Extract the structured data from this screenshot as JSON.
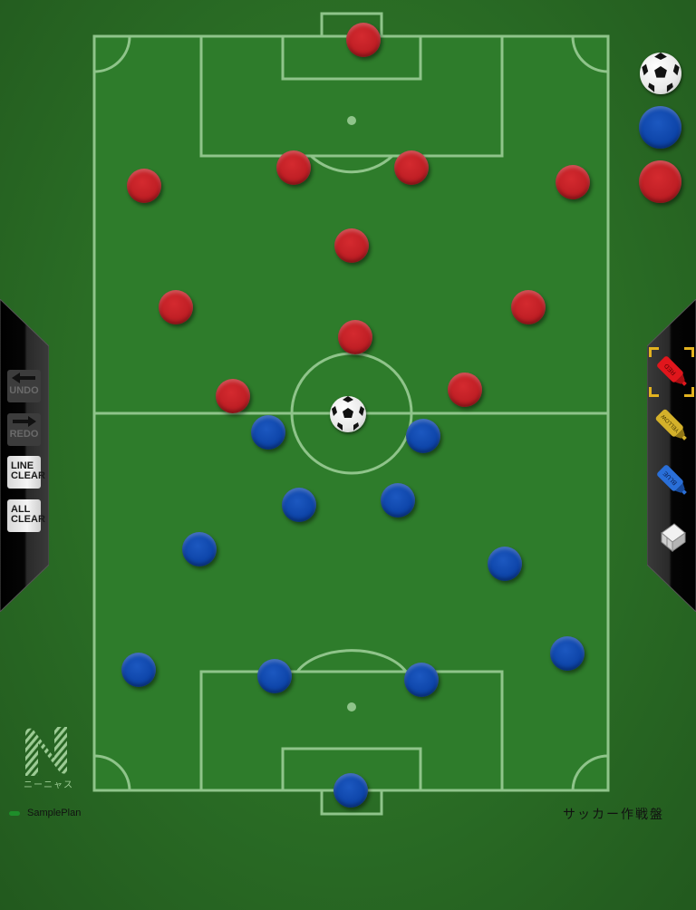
{
  "app": {
    "title": "サッカー作戦盤",
    "brand_text": "ニーニャス",
    "plan_name": "SamplePlan"
  },
  "colors": {
    "pitch": "#2e7c2b",
    "background": "#2a6a25",
    "line": "#8fc48a",
    "red_team": "#be1e24",
    "blue_team": "#0d44a8",
    "selection": "#e2b21f"
  },
  "left_toolbar": {
    "buttons": [
      {
        "id": "undo",
        "icon": "arrow-left-icon",
        "label": "UNDO",
        "enabled": false
      },
      {
        "id": "redo",
        "icon": "arrow-right-icon",
        "label": "REDO",
        "enabled": false
      },
      {
        "id": "line-clear",
        "label_line1": "LINE",
        "label_line2": "CLEAR",
        "enabled": true
      },
      {
        "id": "all-clear",
        "label_line1": "ALL",
        "label_line2": "CLEAR",
        "enabled": true
      }
    ]
  },
  "right_toolbar": {
    "markers": [
      {
        "id": "red",
        "label": "RED",
        "color": "#e0161c",
        "selected": true
      },
      {
        "id": "yellow",
        "label": "YELLOW",
        "color": "#d4b12a",
        "selected": false
      },
      {
        "id": "blue",
        "label": "BLUE",
        "color": "#2a6fd8",
        "selected": false
      },
      {
        "id": "eraser",
        "label": "",
        "icon": "eraser-icon",
        "selected": false
      }
    ]
  },
  "palette": [
    {
      "type": "ball",
      "name": "palette-ball"
    },
    {
      "type": "blue",
      "name": "palette-blue-piece"
    },
    {
      "type": "red",
      "name": "palette-red-piece"
    }
  ],
  "red_team": [
    {
      "role": "goalkeeper"
    },
    {
      "role": "defender"
    },
    {
      "role": "defender"
    },
    {
      "role": "defender"
    },
    {
      "role": "defender"
    },
    {
      "role": "midfielder"
    },
    {
      "role": "midfielder"
    },
    {
      "role": "midfielder"
    },
    {
      "role": "forward"
    },
    {
      "role": "forward"
    },
    {
      "role": "forward"
    }
  ],
  "blue_team": [
    {
      "role": "goalkeeper"
    },
    {
      "role": "defender"
    },
    {
      "role": "defender"
    },
    {
      "role": "defender"
    },
    {
      "role": "defender"
    },
    {
      "role": "midfielder"
    },
    {
      "role": "midfielder"
    },
    {
      "role": "midfielder"
    },
    {
      "role": "midfielder"
    },
    {
      "role": "forward"
    },
    {
      "role": "forward"
    }
  ]
}
